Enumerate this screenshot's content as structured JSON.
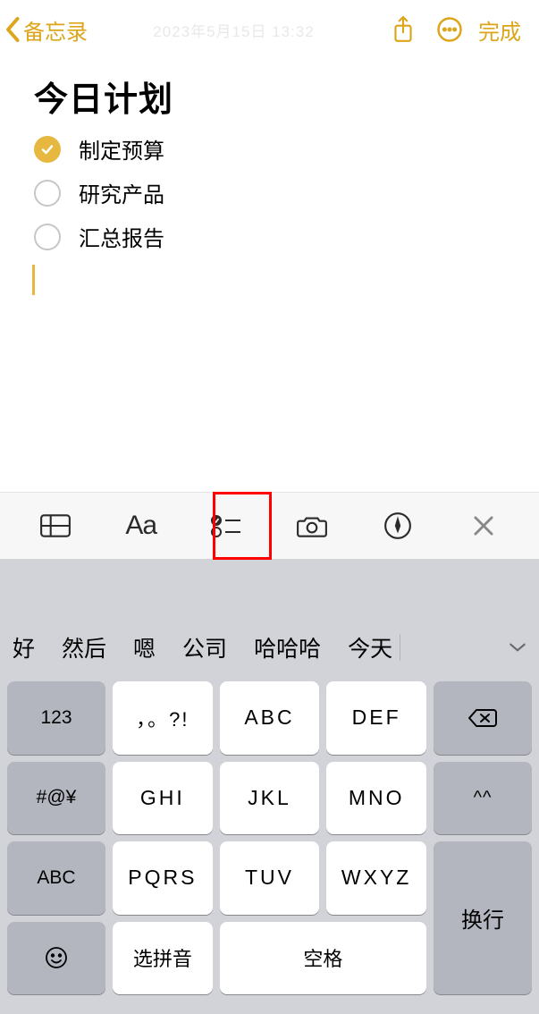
{
  "nav": {
    "back_label": "备忘录",
    "timestamp_ghost": "2023年5月15日 13:32",
    "done_label": "完成"
  },
  "note": {
    "title": "今日计划",
    "items": [
      {
        "text": "制定预算",
        "checked": true
      },
      {
        "text": "研究产品",
        "checked": false
      },
      {
        "text": "汇总报告",
        "checked": false
      }
    ]
  },
  "format_bar": {
    "aa_label": "Aa"
  },
  "keyboard": {
    "candidates": [
      "好",
      "然后",
      "嗯",
      "公司",
      "哈哈哈",
      "今天"
    ],
    "keys": {
      "k123": "123",
      "punct": "，。?!",
      "abc": "ABC",
      "def": "DEF",
      "sym": "#@¥",
      "ghi": "GHI",
      "jkl": "JKL",
      "mno": "MNO",
      "face": "^^",
      "mode_abc": "ABC",
      "pqrs": "PQRS",
      "tuv": "TUV",
      "wxyz": "WXYZ",
      "return": "换行",
      "select_pinyin": "选拼音",
      "space": "空格"
    }
  }
}
